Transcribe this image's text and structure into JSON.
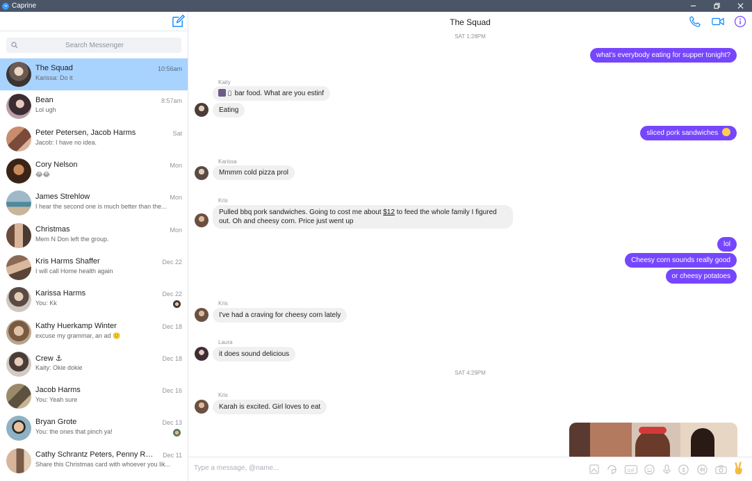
{
  "window": {
    "app_title": "Caprine"
  },
  "sidebar": {
    "search_placeholder": "Search Messenger",
    "conversations": [
      {
        "name": "The Squad",
        "snippet": "Karissa: Do it",
        "time": "10:56am",
        "active": true
      },
      {
        "name": "Bean",
        "snippet": "Lol ugh",
        "time": "8:57am"
      },
      {
        "name": "Peter Petersen, Jacob Harms",
        "snippet": "Jacob: I have no idea.",
        "time": "Sat"
      },
      {
        "name": "Cory Nelson",
        "snippet": "😂😂",
        "time": "Mon"
      },
      {
        "name": "James Strehlow",
        "snippet": "I hear the second one is much better than the...",
        "time": "Mon"
      },
      {
        "name": "Christmas",
        "snippet": "Mem N Don left the group.",
        "time": "Mon"
      },
      {
        "name": "Kris Harms Shaffer",
        "snippet": "I will call Home health again",
        "time": "Dec 22"
      },
      {
        "name": "Karissa Harms",
        "snippet": "You: Kk",
        "time": "Dec 22"
      },
      {
        "name": "Kathy Huerkamp Winter",
        "snippet": "excuse my grammar, an ad 🙂",
        "time": "Dec 18"
      },
      {
        "name": "Crew ⚓",
        "snippet": "Kaity: Okie dokie",
        "time": "Dec 18"
      },
      {
        "name": "Jacob Harms",
        "snippet": "You: Yeah sure",
        "time": "Dec 16"
      },
      {
        "name": "Bryan Grote",
        "snippet": "You: the ones that pinch ya!",
        "time": "Dec 13"
      },
      {
        "name": "Cathy Schrantz Peters, Penny Rosfjor...",
        "snippet": "Share this Christmas card with whoever you lik...",
        "time": "Dec 11"
      }
    ]
  },
  "chat": {
    "title": "The Squad",
    "stamps": [
      "SAT 1:28PM",
      "SAT 4:29PM"
    ],
    "senders": {
      "kaity": "Kaity",
      "karissa": "Karissa",
      "kris": "Kris",
      "laura": "Laura"
    },
    "messages": {
      "m1": "what's everybody eating for supper tonight?",
      "m2": "bar food. What are you estinf",
      "m3": "Eating",
      "m4": "sliced pork sandwiches",
      "m5": "Mmmm cold pizza prol",
      "m6a": "Pulled bbq pork sandwiches. Going to cost me about ",
      "m6b": "$12",
      "m6c": " to feed the whole family I figured out. Oh and cheesy corn. Price just went up",
      "m7": "lol",
      "m8": "Cheesy corn sounds really good",
      "m9": "or cheesy potatoes",
      "m10": "I've had a craving for cheesy corn lately",
      "m11": "it does sound delicious",
      "m12": "Karah is excited. Girl loves to eat"
    },
    "composer_placeholder": "Type a message, @name..."
  },
  "colors": {
    "accent": "#7646ff",
    "active_row": "#a9d3ff",
    "titlebar": "#4a5667",
    "icon_blue": "#0084ff"
  }
}
